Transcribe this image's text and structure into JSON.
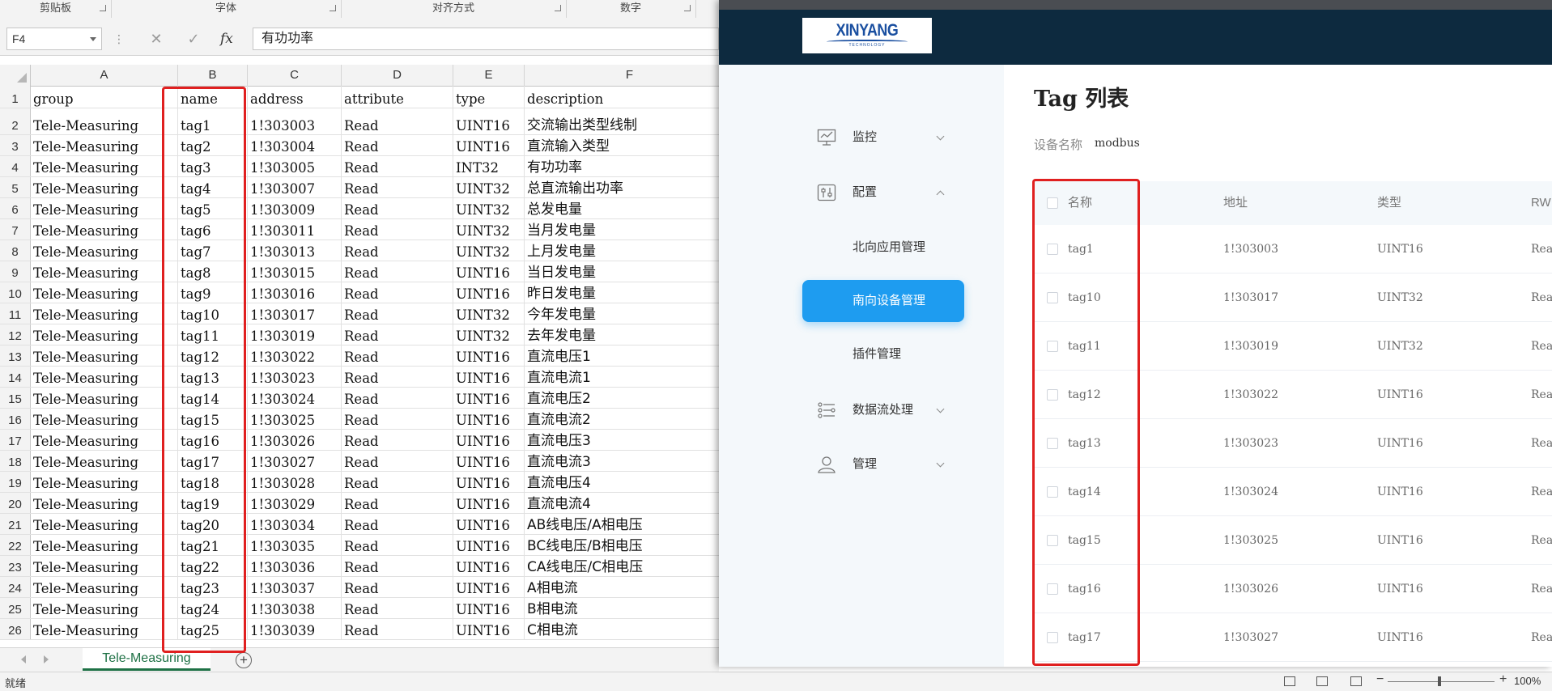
{
  "excel": {
    "ribbon_groups": [
      "剪贴板",
      "字体",
      "对齐方式",
      "数字"
    ],
    "name_box": "F4",
    "formula_buttons": {
      "cancel": "✕",
      "enter": "✓"
    },
    "fx_label": "fx",
    "formula_value": "有功功率",
    "column_headers": [
      "A",
      "B",
      "C",
      "D",
      "E",
      "F"
    ],
    "rows": [
      {
        "n": "1",
        "cells": [
          "group",
          "name",
          "address",
          "attribute",
          "type",
          "description"
        ]
      },
      {
        "n": "2",
        "cells": [
          "Tele-Measuring",
          "tag1",
          "1!303003",
          "Read",
          "UINT16",
          "交流输出类型线制"
        ]
      },
      {
        "n": "3",
        "cells": [
          "Tele-Measuring",
          "tag2",
          "1!303004",
          "Read",
          "UINT16",
          "直流输入类型"
        ]
      },
      {
        "n": "4",
        "cells": [
          "Tele-Measuring",
          "tag3",
          "1!303005",
          "Read",
          "INT32",
          "有功功率"
        ]
      },
      {
        "n": "5",
        "cells": [
          "Tele-Measuring",
          "tag4",
          "1!303007",
          "Read",
          "UINT32",
          "总直流输出功率"
        ]
      },
      {
        "n": "6",
        "cells": [
          "Tele-Measuring",
          "tag5",
          "1!303009",
          "Read",
          "UINT32",
          "总发电量"
        ]
      },
      {
        "n": "7",
        "cells": [
          "Tele-Measuring",
          "tag6",
          "1!303011",
          "Read",
          "UINT32",
          "当月发电量"
        ]
      },
      {
        "n": "8",
        "cells": [
          "Tele-Measuring",
          "tag7",
          "1!303013",
          "Read",
          "UINT32",
          "上月发电量"
        ]
      },
      {
        "n": "9",
        "cells": [
          "Tele-Measuring",
          "tag8",
          "1!303015",
          "Read",
          "UINT16",
          "当日发电量"
        ]
      },
      {
        "n": "10",
        "cells": [
          "Tele-Measuring",
          "tag9",
          "1!303016",
          "Read",
          "UINT16",
          "昨日发电量"
        ]
      },
      {
        "n": "11",
        "cells": [
          "Tele-Measuring",
          "tag10",
          "1!303017",
          "Read",
          "UINT32",
          "今年发电量"
        ]
      },
      {
        "n": "12",
        "cells": [
          "Tele-Measuring",
          "tag11",
          "1!303019",
          "Read",
          "UINT32",
          "去年发电量"
        ]
      },
      {
        "n": "13",
        "cells": [
          "Tele-Measuring",
          "tag12",
          "1!303022",
          "Read",
          "UINT16",
          "直流电压1"
        ]
      },
      {
        "n": "14",
        "cells": [
          "Tele-Measuring",
          "tag13",
          "1!303023",
          "Read",
          "UINT16",
          "直流电流1"
        ]
      },
      {
        "n": "15",
        "cells": [
          "Tele-Measuring",
          "tag14",
          "1!303024",
          "Read",
          "UINT16",
          "直流电压2"
        ]
      },
      {
        "n": "16",
        "cells": [
          "Tele-Measuring",
          "tag15",
          "1!303025",
          "Read",
          "UINT16",
          "直流电流2"
        ]
      },
      {
        "n": "17",
        "cells": [
          "Tele-Measuring",
          "tag16",
          "1!303026",
          "Read",
          "UINT16",
          "直流电压3"
        ]
      },
      {
        "n": "18",
        "cells": [
          "Tele-Measuring",
          "tag17",
          "1!303027",
          "Read",
          "UINT16",
          "直流电流3"
        ]
      },
      {
        "n": "19",
        "cells": [
          "Tele-Measuring",
          "tag18",
          "1!303028",
          "Read",
          "UINT16",
          "直流电压4"
        ]
      },
      {
        "n": "20",
        "cells": [
          "Tele-Measuring",
          "tag19",
          "1!303029",
          "Read",
          "UINT16",
          "直流电流4"
        ]
      },
      {
        "n": "21",
        "cells": [
          "Tele-Measuring",
          "tag20",
          "1!303034",
          "Read",
          "UINT16",
          "AB线电压/A相电压"
        ]
      },
      {
        "n": "22",
        "cells": [
          "Tele-Measuring",
          "tag21",
          "1!303035",
          "Read",
          "UINT16",
          "BC线电压/B相电压"
        ]
      },
      {
        "n": "23",
        "cells": [
          "Tele-Measuring",
          "tag22",
          "1!303036",
          "Read",
          "UINT16",
          "CA线电压/C相电压"
        ]
      },
      {
        "n": "24",
        "cells": [
          "Tele-Measuring",
          "tag23",
          "1!303037",
          "Read",
          "UINT16",
          "A相电流"
        ]
      },
      {
        "n": "25",
        "cells": [
          "Tele-Measuring",
          "tag24",
          "1!303038",
          "Read",
          "UINT16",
          "B相电流"
        ]
      },
      {
        "n": "26",
        "cells": [
          "Tele-Measuring",
          "tag25",
          "1!303039",
          "Read",
          "UINT16",
          "C相电流"
        ]
      }
    ],
    "sheet_tab": "Tele-Measuring",
    "add_sheet": "+",
    "status": "就绪",
    "zoom": {
      "minus": "−",
      "plus": "+",
      "percent": "100%"
    }
  },
  "app": {
    "logo": {
      "text": "XINYANG",
      "sub": "TECHNOLOGY"
    },
    "nav": [
      {
        "label": "监控",
        "icon": "monitor-icon",
        "expanded": false
      },
      {
        "label": "配置",
        "icon": "config-icon",
        "expanded": true
      },
      {
        "label": "数据流处理",
        "icon": "dataflow-icon",
        "expanded": false
      },
      {
        "label": "管理",
        "icon": "user-icon",
        "expanded": false
      }
    ],
    "subnav": [
      {
        "label": "北向应用管理",
        "active": false
      },
      {
        "label": "南向设备管理",
        "active": true
      },
      {
        "label": "插件管理",
        "active": false
      }
    ],
    "page_title": "Tag 列表",
    "device_label": "设备名称",
    "device_value": "modbus",
    "table_headers": [
      "名称",
      "地址",
      "类型",
      "RW"
    ],
    "table_rows": [
      {
        "name": "tag1",
        "address": "1!303003",
        "type": "UINT16",
        "rw": "Read"
      },
      {
        "name": "tag10",
        "address": "1!303017",
        "type": "UINT32",
        "rw": "Read"
      },
      {
        "name": "tag11",
        "address": "1!303019",
        "type": "UINT32",
        "rw": "Read"
      },
      {
        "name": "tag12",
        "address": "1!303022",
        "type": "UINT16",
        "rw": "Read"
      },
      {
        "name": "tag13",
        "address": "1!303023",
        "type": "UINT16",
        "rw": "Read"
      },
      {
        "name": "tag14",
        "address": "1!303024",
        "type": "UINT16",
        "rw": "Read"
      },
      {
        "name": "tag15",
        "address": "1!303025",
        "type": "UINT16",
        "rw": "Read"
      },
      {
        "name": "tag16",
        "address": "1!303026",
        "type": "UINT16",
        "rw": "Read"
      },
      {
        "name": "tag17",
        "address": "1!303027",
        "type": "UINT16",
        "rw": "Read"
      }
    ]
  },
  "colors": {
    "excel_green": "#1e7145",
    "highlight_red": "#e02020",
    "header_navy": "#0d2a3f",
    "active_blue": "#1e9cf0",
    "sidebar_bg": "#f4f8fb"
  }
}
